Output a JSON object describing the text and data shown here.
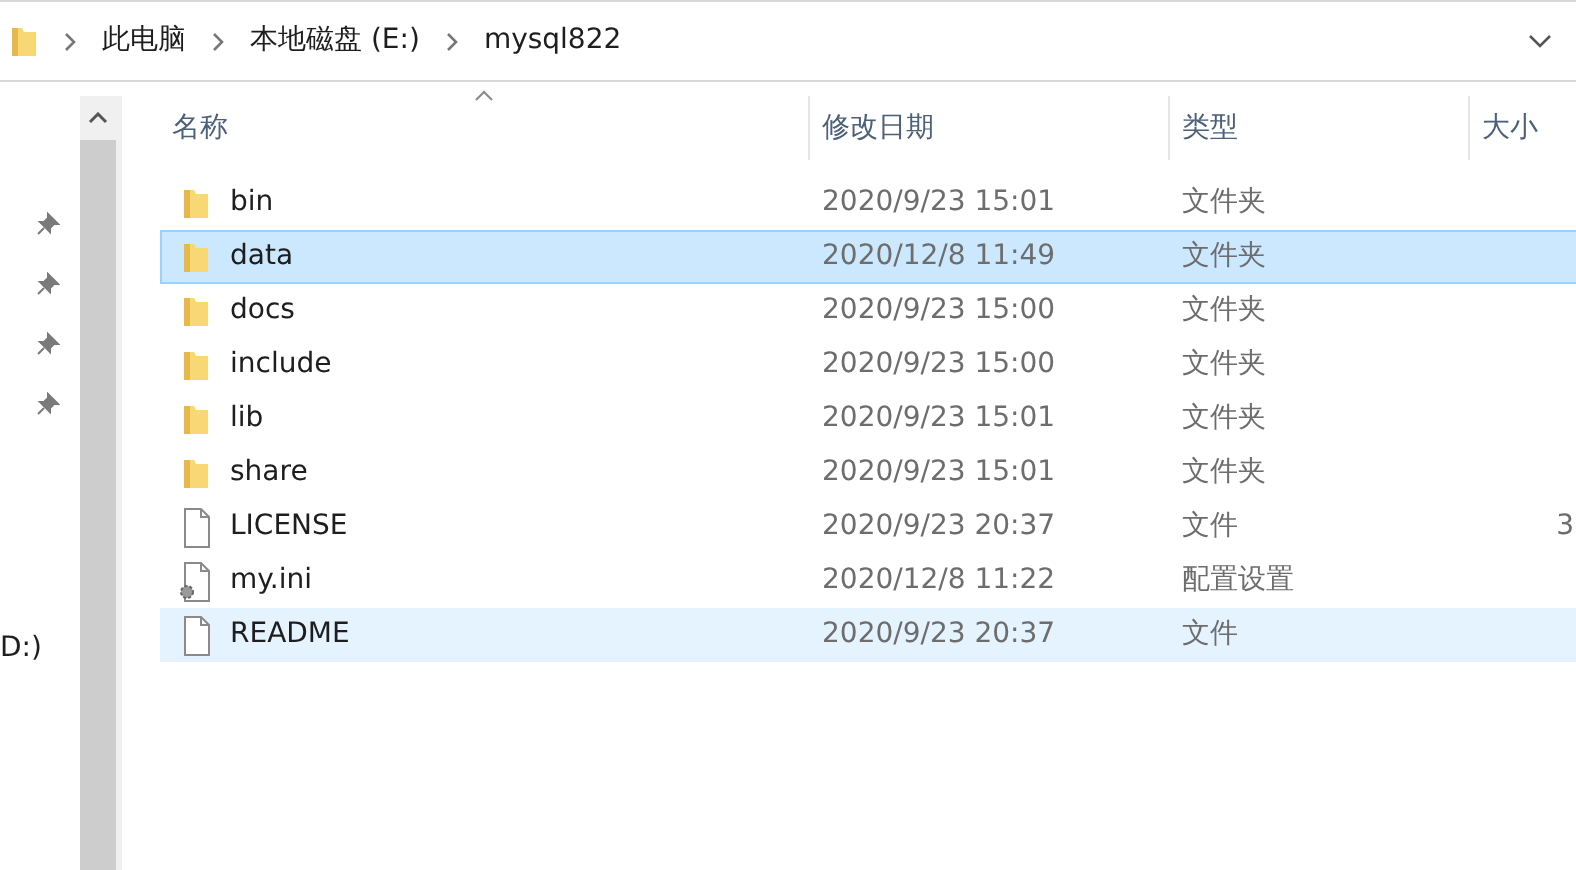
{
  "breadcrumb": [
    "此电脑",
    "本地磁盘 (E:)",
    "mysql822"
  ],
  "nav_pane": {
    "pinned_count_items": [
      {
        "kind": "pin"
      },
      {
        "kind": "pin"
      },
      {
        "kind": "pin"
      },
      {
        "kind": "pin"
      }
    ],
    "drive_label": "D:)"
  },
  "table": {
    "columns": [
      "名称",
      "修改日期",
      "类型",
      "大小"
    ],
    "rows": [
      {
        "kind": "folder",
        "name": "bin",
        "date": "2020/9/23 15:01",
        "type": "文件夹",
        "selected": false,
        "hovered": false
      },
      {
        "kind": "folder",
        "name": "data",
        "date": "2020/12/8 11:49",
        "type": "文件夹",
        "selected": true,
        "hovered": false
      },
      {
        "kind": "folder",
        "name": "docs",
        "date": "2020/9/23 15:00",
        "type": "文件夹",
        "selected": false,
        "hovered": false
      },
      {
        "kind": "folder",
        "name": "include",
        "date": "2020/9/23 15:00",
        "type": "文件夹",
        "selected": false,
        "hovered": false
      },
      {
        "kind": "folder",
        "name": "lib",
        "date": "2020/9/23 15:01",
        "type": "文件夹",
        "selected": false,
        "hovered": false
      },
      {
        "kind": "folder",
        "name": "share",
        "date": "2020/9/23 15:01",
        "type": "文件夹",
        "selected": false,
        "hovered": false
      },
      {
        "kind": "file",
        "name": "LICENSE",
        "date": "2020/9/23 20:37",
        "type": "文件",
        "size": "3",
        "selected": false,
        "hovered": false
      },
      {
        "kind": "settings",
        "name": "my.ini",
        "date": "2020/12/8 11:22",
        "type": "配置设置",
        "selected": false,
        "hovered": false
      },
      {
        "kind": "file",
        "name": "README",
        "date": "2020/9/23 20:37",
        "type": "文件",
        "selected": false,
        "hovered": true
      }
    ]
  }
}
